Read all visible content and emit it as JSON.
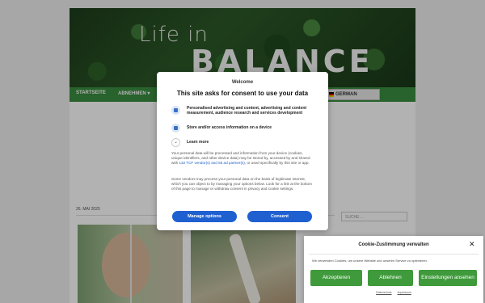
{
  "site": {
    "logo_line1": "Life in",
    "logo_line2": "BALANCE",
    "nav": [
      "STARTSEITE",
      "ABNEHMEN ▾"
    ],
    "language": "GERMAN",
    "date": "26. MAI 2025",
    "search_placeholder": "SUCHE ..."
  },
  "consent": {
    "welcome": "Welcome",
    "title": "This site asks for consent to use your data",
    "purposes": [
      {
        "icon": "person-icon",
        "label": "Personalised advertising and content, advertising and content measurement, audience research and services development"
      },
      {
        "icon": "device-icon",
        "label": "Store and/or access information on a device"
      }
    ],
    "learn_more": "Learn more",
    "paragraph1_a": "Your personal data will be processed and information from your device (cookies, unique identifiers, and other device data) may be stored by, accessed by and shared with ",
    "paragraph1_link": "132 TCF vendor(s) and 65 ad partner(s)",
    "paragraph1_b": ", or used specifically by this site or app.",
    "paragraph2": "Some vendors may process your personal data on the basis of legitimate interest, which you can object to by managing your options below. Look for a link at the bottom of this page to manage or withdraw consent in privacy and cookie settings.",
    "manage_label": "Manage options",
    "consent_label": "Consent"
  },
  "cookie_banner": {
    "title": "Cookie-Zustimmung verwalten",
    "close": "✕",
    "text": "Wir verwenden Cookies, um unsere Website und unseren Service zu optimieren.",
    "accept": "Akzeptieren",
    "reject": "Ablehnen",
    "settings": "Einstellungen ansehen",
    "links": [
      "Datenschutz",
      "Impressum"
    ]
  },
  "colors": {
    "accent_blue": "#1f60d1",
    "nav_green": "#3a8d3f",
    "cookie_green": "#3f9a3b"
  }
}
